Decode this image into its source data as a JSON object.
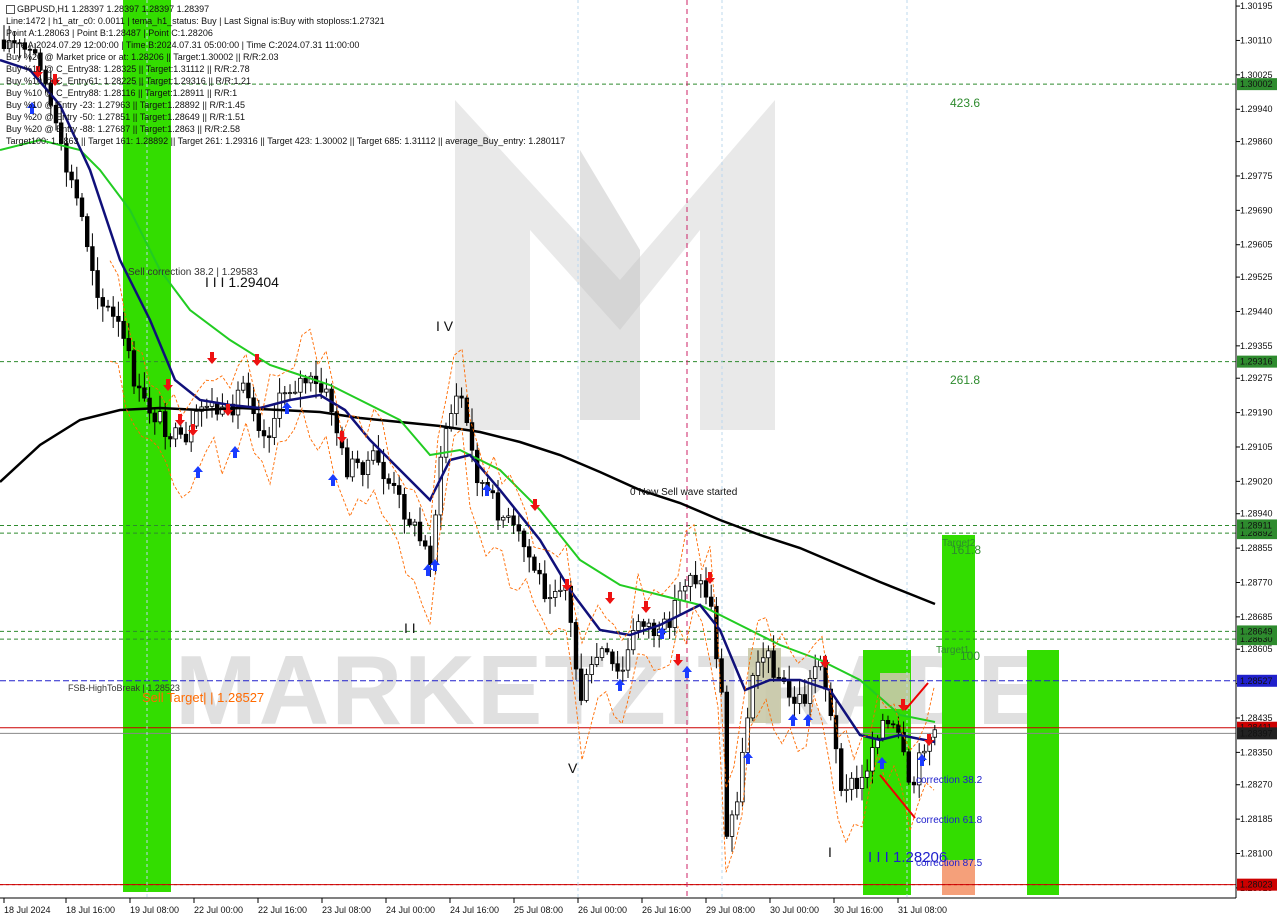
{
  "header": {
    "symbol_line": "GBPUSD,H1  1.28397 1.28397 1.28397 1.28397",
    "lines": [
      "Line:1472  | h1_atr_c0: 0.0011  | tema_h1_status: Buy  | Last Signal is:Buy with stoploss:1.27321",
      "Point A:1.28063 | Point B:1.28487 | Point C:1.28206",
      "Time A:2024.07.29 12:00:00 | Time B:2024.07.31 05:00:00 | Time C:2024.07.31 11:00:00",
      "Buy %20 @ Market price or at: 1.28206 || Target:1.30002 || R/R:2.03",
      "Buy %10 @ C_Entry38: 1.28325 || Target:1.31112 || R/R:2.78",
      "Buy %10 @ C_Entry61: 1.28225 || Target:1.29316 || R/R:1.21",
      "Buy %10 @ C_Entry88: 1.28116 || Target:1.28911 || R/R:1",
      "Buy %10 @ Entry -23: 1.27963 || Target:1.28892 || R/R:1.45",
      "Buy %20 @ Entry -50: 1.27851 || Target:1.28649 || R/R:1.51",
      "Buy %20 @ Entry -88: 1.27687 || Target:1.2863 || R/R:2.58",
      "Target100: 1.2863 || Target 161: 1.28892 || Target 261: 1.29316 || Target 423: 1.30002 || Target 685: 1.31112 || average_Buy_entry: 1.280117"
    ]
  },
  "colors": {
    "background": "#ffffff",
    "candle": "#000000",
    "green_band": "#33dd00",
    "sell_zone": "#f5a07a",
    "ma_black": "#000000",
    "ma_green": "#22cc22",
    "ma_navy": "#10107a",
    "envelope": "#ff6a00",
    "level_green": "#2e8b2e",
    "level_red": "#cc0000",
    "level_blue": "#2020cc",
    "arrow_buy": "#1a3cff",
    "arrow_sell": "#ee1111"
  },
  "chart_data": {
    "type": "candlestick",
    "symbol": "GBPUSD",
    "timeframe": "H1",
    "ylim": [
      1.2799,
      1.3021
    ],
    "y_ticks": [
      "1.30195",
      "1.30110",
      "1.30025",
      "1.29940",
      "1.29860",
      "1.29775",
      "1.29690",
      "1.29605",
      "1.29525",
      "1.29440",
      "1.29355",
      "1.29275",
      "1.29190",
      "1.29105",
      "1.29020",
      "1.28940",
      "1.28855",
      "1.28770",
      "1.28685",
      "1.28605",
      "1.28520",
      "1.28435",
      "1.28350",
      "1.28270",
      "1.28185",
      "1.28100",
      "1.28015"
    ],
    "x_ticks": [
      "18 Jul 2024",
      "18 Jul 16:00",
      "19 Jul 08:00",
      "22 Jul 00:00",
      "22 Jul 16:00",
      "23 Jul 08:00",
      "24 Jul 00:00",
      "24 Jul 16:00",
      "25 Jul 08:00",
      "26 Jul 00:00",
      "26 Jul 16:00",
      "29 Jul 08:00",
      "30 Jul 00:00",
      "30 Jul 16:00",
      "31 Jul 08:00"
    ],
    "levels": [
      {
        "label": "423.6",
        "value": 1.30002,
        "price_tag": "1.30002",
        "style": "green"
      },
      {
        "label": "261.8",
        "value": 1.29316,
        "price_tag": "1.29316",
        "style": "green"
      },
      {
        "label": "161.8",
        "value": 1.28892,
        "price_tag": "1.28892",
        "style": "green"
      },
      {
        "label": "",
        "value": 1.28911,
        "price_tag": "1.28911",
        "style": "green"
      },
      {
        "label": "100",
        "value": 1.2863,
        "price_tag": "1.28630",
        "style": "green"
      },
      {
        "label": "",
        "value": 1.28649,
        "price_tag": "1.28649",
        "style": "green"
      },
      {
        "label": "",
        "value": 1.28527,
        "price_tag": "1.28527",
        "style": "blue"
      },
      {
        "label": "",
        "value": 1.28411,
        "price_tag": "1.28411",
        "style": "red"
      },
      {
        "label": "",
        "value": 1.28397,
        "price_tag": "1.28397",
        "style": "gray"
      },
      {
        "label": "",
        "value": 1.28023,
        "price_tag": "1.28023",
        "style": "red"
      }
    ],
    "annotations": [
      {
        "text": "Sell correction 38.2 | 1.29583",
        "kind": "small"
      },
      {
        "text": "I I I 1.29404",
        "kind": "large"
      },
      {
        "text": "I V",
        "kind": "large"
      },
      {
        "text": "0 New Sell wave started",
        "kind": "small"
      },
      {
        "text": "I I",
        "kind": "large"
      },
      {
        "text": "V",
        "kind": "large"
      },
      {
        "text": "FSB-HighToBreak | 1.28523",
        "kind": "small"
      },
      {
        "text": "Sell Target| | 1.28527",
        "kind": "orange"
      },
      {
        "text": "Target2",
        "kind": "green"
      },
      {
        "text": "Target1",
        "kind": "green"
      },
      {
        "text": "correction 38.2",
        "kind": "blue"
      },
      {
        "text": "correction 61.8",
        "kind": "blue"
      },
      {
        "text": "correction 87.5",
        "kind": "blue"
      },
      {
        "text": "I I I 1.28206",
        "kind": "bluelarge"
      },
      {
        "text": "I",
        "kind": "large"
      }
    ],
    "watermark": "MARKETZITRADE"
  }
}
